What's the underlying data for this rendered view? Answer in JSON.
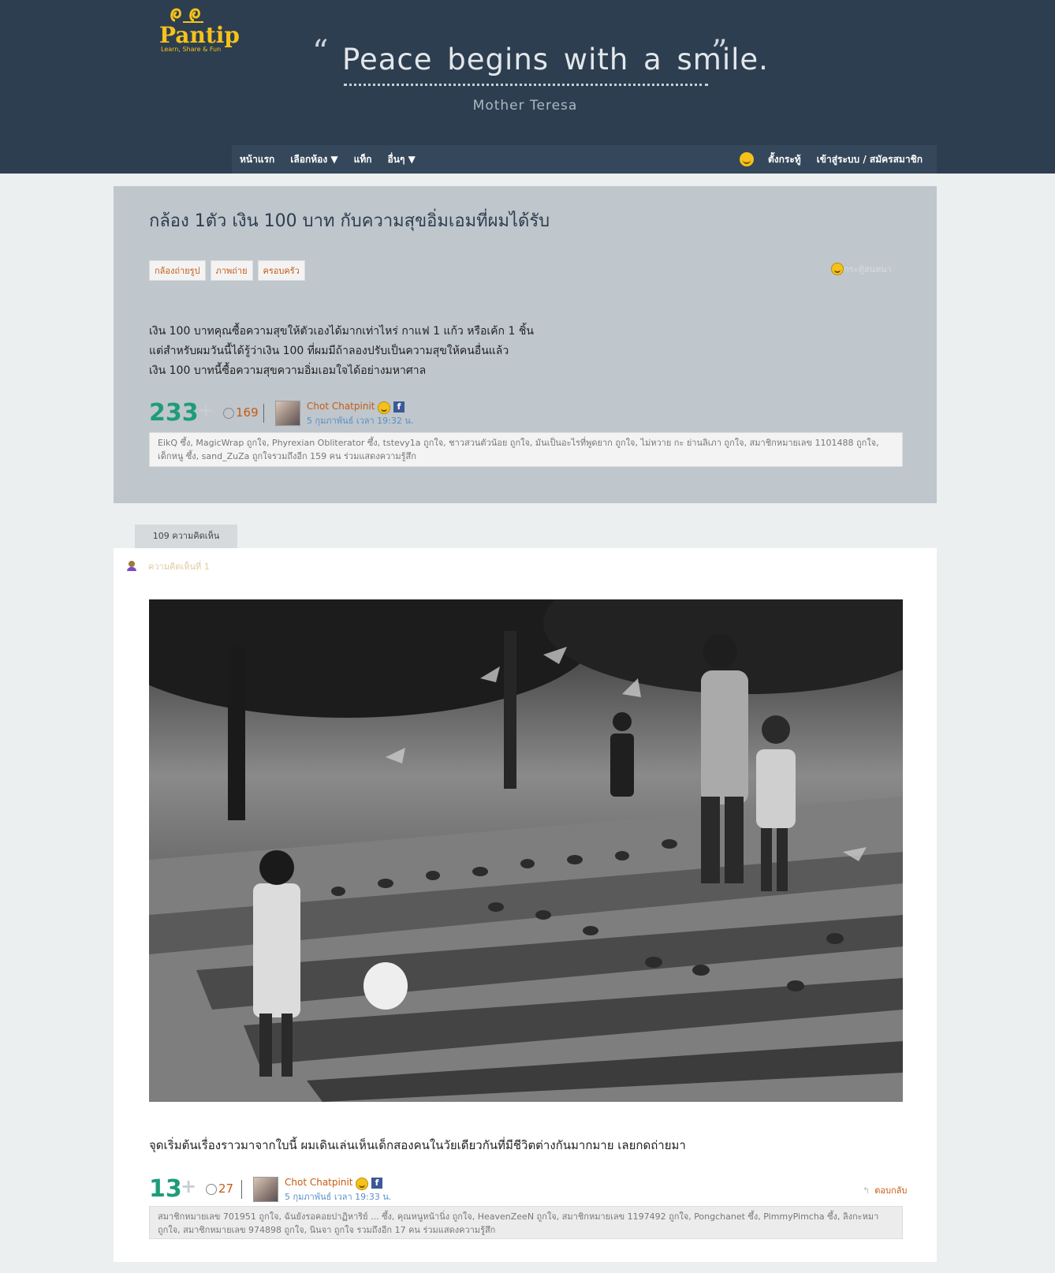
{
  "brand": {
    "name": "Pantip",
    "tagline": "Learn, Share & Fun",
    "primary_color": "#2d3e50",
    "accent_color": "#f5c21b"
  },
  "quote": {
    "open": "“",
    "text": "Peace begins with a smile.",
    "close": "”",
    "author": "Mother Teresa"
  },
  "nav": {
    "items": [
      "หน้าแรก",
      "เลือกห้อง ▼",
      "แท็ก",
      "อื่นๆ ▼"
    ],
    "post_label": "ตั้งกระทู้",
    "login_label": "เข้าสู่ระบบ / สมัครสมาชิก"
  },
  "topic": {
    "title": "กล้อง 1ตัว เงิน 100 บาท กับความสุขอิ่มเอมที่ผมได้รับ",
    "tags": [
      "กล้องถ่ายรูป",
      "ภาพถ่าย",
      "ครอบครัว"
    ],
    "type_label": "กระทู้สนทนา",
    "body": [
      "เงิน 100 บาทคุณซื้อความสุขให้ตัวเองได้มากเท่าไหร่ กาแฟ 1 แก้ว หรือเค้ก 1 ชิ้น",
      "แต่สำหรับผมวันนี้ได้รู้ว่าเงิน 100 ที่ผมมีถ้าลองปรับเป็นความสุขให้คนอื่นแล้ว",
      "เงิน 100 บาทนี้ซื้อความสุขความอิ่มเอมใจได้อย่างมหาศาล"
    ],
    "votes": "233",
    "emotions": "169",
    "author": "Chot Chatpinit",
    "date": "5 กุมภาพันธ์ เวลา 19:32 น.",
    "reactions": "EikQ ซึ้ง, MagicWrap ถูกใจ, Phyrexian Obliterator ซึ้ง, tstevy1a ถูกใจ, ชาวสวนตัวน้อย ถูกใจ, มันเป็นอะไรที่พูดยาก ถูกใจ, ไม่หวาย กะ ย่านลิเภา ถูกใจ, สมาชิกหมายเลข 1101488 ถูกใจ, เด็กหนู ซึ้ง, sand_ZuZa ถูกใจรวมถึงอีก 159 คน ร่วมแสดงความรู้สึก"
  },
  "comments": {
    "count_label": "109 ความคิดเห็น",
    "first": {
      "label": "ความคิดเห็นที่ 1",
      "body": "จุดเริ่มต้นเรื่องราวมาจากใบนี้ ผมเดินเล่นเห็นเด็กสองคนในวัยเดียวกันที่มีชีวิตต่างกันมากมาย เลยกดถ่ายมา",
      "votes": "13",
      "emotions": "27",
      "author": "Chot Chatpinit",
      "date": "5 กุมภาพันธ์ เวลา 19:33 น.",
      "reply_label": "ตอบกลับ",
      "reactions": "สมาชิกหมายเลข 701951 ถูกใจ, ฉันยังรอคอยปาฏิหาริย์ ... ซึ้ง, คุณหนูหน้านิ่ง ถูกใจ, HeavenZeeN ถูกใจ, สมาชิกหมายเลข 1197492 ถูกใจ, Pongchanet ซึ้ง, PimmyPimcha ซึ้ง, ลิงกะหมา ถูกใจ, สมาชิกหมายเลข 974898 ถูกใจ, นินจา ถูกใจ รวมถึงอีก 17 คน ร่วมแสดงความรู้สึก"
    }
  }
}
